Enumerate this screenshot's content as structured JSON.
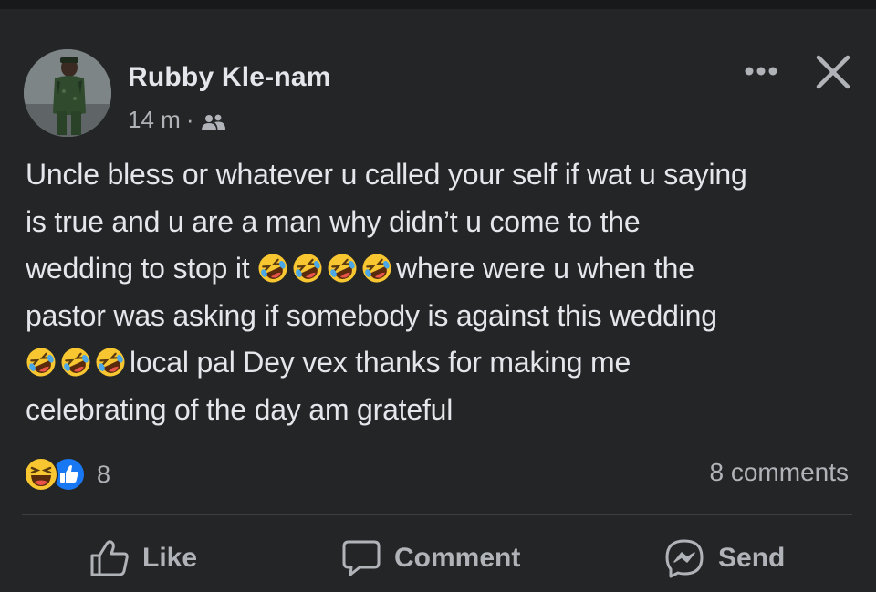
{
  "post": {
    "author": "Rubby Kle-nam",
    "time": "14 m",
    "separator": "·",
    "audience_icon": "friends-icon",
    "lines": [
      {
        "pre_emoji": 0,
        "text": "Uncle bless or whatever u called your self if wat u saying",
        "emoji_after": 0
      },
      {
        "pre_emoji": 0,
        "text": "is true and u are a man why didn’t u come to the",
        "emoji_after": 0
      },
      {
        "pre_emoji": 0,
        "text": "wedding to stop it ",
        "emoji_after": 4,
        "tail": "where were u when the"
      },
      {
        "pre_emoji": 0,
        "text": "pastor was asking if somebody is against this wedding",
        "emoji_after": 0
      },
      {
        "pre_emoji": 3,
        "text": "local pal Dey vex thanks for making me",
        "emoji_after": 0
      },
      {
        "pre_emoji": 0,
        "text": "celebrating of the day am grateful",
        "emoji_after": 0
      }
    ],
    "emoji_icon": "rolling-on-floor-laughing-emoji"
  },
  "reactions": {
    "icons": [
      "haha-reaction-icon",
      "like-reaction-icon"
    ],
    "count": "8"
  },
  "comments_count": "8 comments",
  "actions": {
    "like": "Like",
    "comment": "Comment",
    "send": "Send"
  },
  "header_icons": [
    "more-options-icon",
    "close-icon"
  ],
  "colors": {
    "background": "#242526",
    "text_primary": "#e4e6eb",
    "text_secondary": "#b0b3b8",
    "like_blue": "#1877f2",
    "haha_yellow": "#f7c631"
  }
}
